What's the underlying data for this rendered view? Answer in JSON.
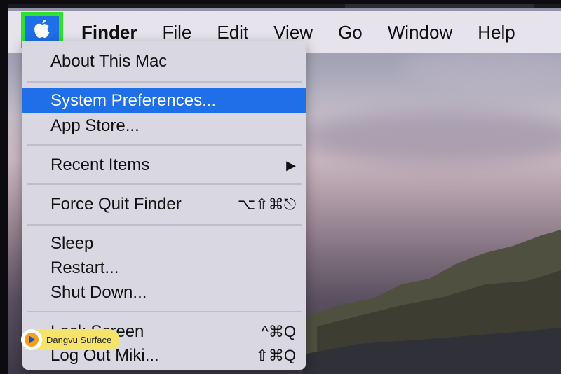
{
  "menubar": {
    "apple_icon": "apple-icon",
    "app_name": "Finder",
    "items": [
      "File",
      "Edit",
      "View",
      "Go",
      "Window",
      "Help"
    ]
  },
  "apple_menu": {
    "about": "About This Mac",
    "system_preferences": "System Preferences...",
    "app_store": "App Store...",
    "recent_items": "Recent Items",
    "recent_items_arrow": "▶",
    "force_quit": "Force Quit Finder",
    "force_quit_shortcut": "⌥⇧⌘⎋",
    "sleep": "Sleep",
    "restart": "Restart...",
    "shut_down": "Shut Down...",
    "lock_screen": "Lock Screen",
    "lock_screen_shortcut": "^⌘Q",
    "log_out": "Log Out Miki...",
    "log_out_shortcut": "⇧⌘Q"
  },
  "watermark": {
    "label": "Dangvu Surface"
  },
  "colors": {
    "highlight": "#1e6fe8",
    "apple_button_border": "#2fe12f",
    "menu_bg": "#d9d7e1",
    "menubar_bg": "#e6e3ec"
  }
}
